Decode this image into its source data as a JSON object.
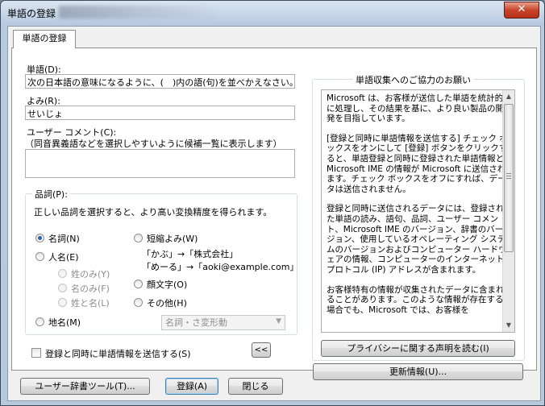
{
  "window": {
    "title": "単語の登録",
    "close_label": "✕"
  },
  "tab": {
    "label": "単語の登録"
  },
  "word": {
    "label": "単語(D):",
    "value": "次の日本語の意味になるように、(　)内の語(句)を並べかえなさい。但"
  },
  "reading": {
    "label": "よみ(R):",
    "value": "せいじょ"
  },
  "comment": {
    "label": "ユーザー コメント(C):",
    "hint": "（同音異義語などを選択しやすいように候補一覧に表示します）",
    "value": ""
  },
  "pos": {
    "group_label": "品詞(P):",
    "description": "正しい品詞を選択すると、より高い変換精度を得られます。",
    "options": {
      "noun": {
        "label": "名詞(N)",
        "checked": true,
        "disabled": false
      },
      "person": {
        "label": "人名(E)",
        "checked": false,
        "disabled": false
      },
      "surname_only": {
        "label": "姓のみ(Y)",
        "checked": false,
        "disabled": true
      },
      "given_only": {
        "label": "名のみ(F)",
        "checked": false,
        "disabled": true
      },
      "full_name": {
        "label": "姓と名(L)",
        "checked": false,
        "disabled": true
      },
      "place": {
        "label": "地名(M)",
        "checked": false,
        "disabled": false
      },
      "abbrev": {
        "label": "短縮よみ(W)",
        "checked": false,
        "disabled": false
      },
      "emoticon": {
        "label": "顔文字(O)",
        "checked": false,
        "disabled": false
      },
      "other": {
        "label": "その他(H)",
        "checked": false,
        "disabled": false
      }
    },
    "abbrev_example1": "「かぶ」→「株式会社」",
    "abbrev_example2": "「めーる」→「aoki@example.com」",
    "other_select": "名詞・さ変形動"
  },
  "send_info_checkbox": {
    "label": "登録と同時に単語情報を送信する(S)",
    "checked": false
  },
  "collapse_button": {
    "label": "<<"
  },
  "info_panel": {
    "title": "単語収集へのご協力のお願い",
    "paragraphs": [
      "Microsoft は、お客様が送信した単語を統計的に処理し、その結果を基に、より良い製品の開発を目指しています。",
      "[登録と同時に単語情報を送信する] チェック ボックスをオンにして [登録] ボタンをクリックすると、単語登録と同時に登録された単語情報と Microsoft IME の情報が Microsoft に送信されます。チェック ボックスをオフにすれば、データは送信されません。",
      "登録と同時に送信されるデータには、登録された単語の読み、語句、品詞、ユーザー コメント、Microsoft IME のバージョン、辞書のバージョン、使用しているオペレーティング システムのバージョンおよびコンピューター ハードウェアの情報、コンピューターのインターネット プロトコル (IP) アドレスが含まれます。",
      "お客様特有の情報が収集されたデータに含まれることがあります。このような情報が存在する場合でも、Microsoft では、お客様を"
    ],
    "privacy_button": "プライバシーに関する声明を読む(I)",
    "update_button": "更新情報(U)..."
  },
  "footer": {
    "dict_tool_button": "ユーザー辞書ツール(T)...",
    "register_button": "登録(A)",
    "close_button": "閉じる"
  }
}
